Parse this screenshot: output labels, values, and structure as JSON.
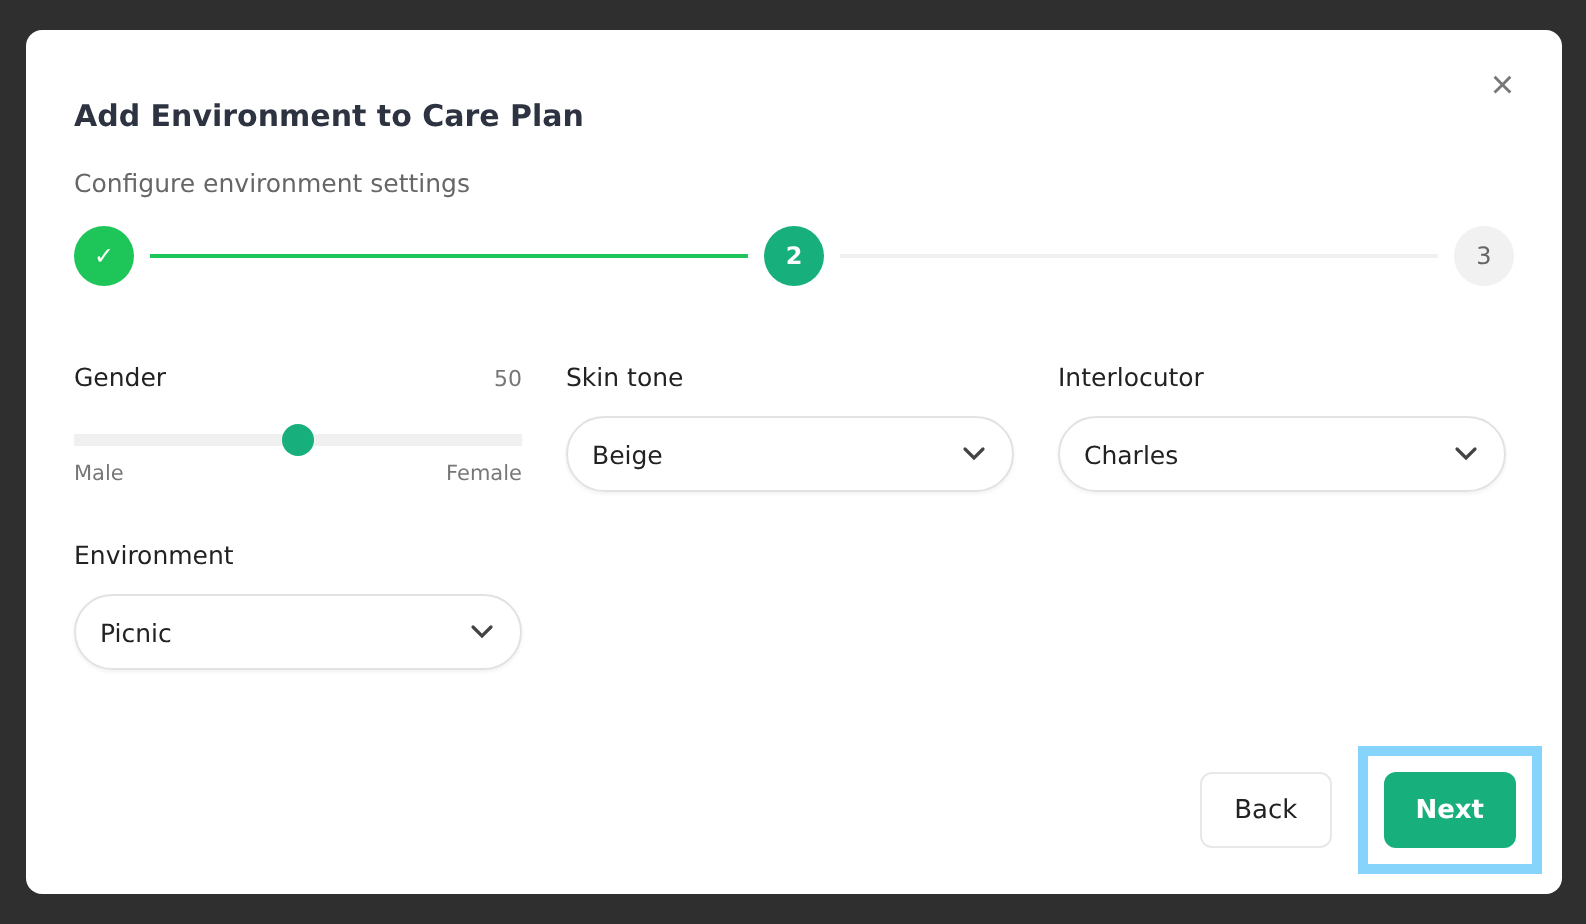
{
  "dialog": {
    "title": "Add Environment to Care Plan",
    "subtitle": "Configure environment settings",
    "close": "×"
  },
  "steps": [
    {
      "label": "✓",
      "completed": true,
      "selected": false
    },
    {
      "label": "2",
      "completed": false,
      "selected": true
    },
    {
      "label": "3",
      "completed": false,
      "selected": false
    }
  ],
  "fields": [
    {
      "kind": "slider",
      "label": "Gender",
      "reading": "50",
      "level": 0.5,
      "min_label": "Male",
      "max_label": "Female"
    },
    {
      "kind": "select",
      "label": "Skin tone",
      "value": "Beige"
    },
    {
      "kind": "select",
      "label": "Interlocutor",
      "value": "Charles"
    },
    {
      "kind": "select",
      "label": "Environment",
      "value": "Picnic"
    }
  ],
  "buttons": [
    {
      "label": "Back",
      "kind": "secondary",
      "focused": false
    },
    {
      "label": "Next",
      "kind": "primary",
      "focused": true
    }
  ]
}
